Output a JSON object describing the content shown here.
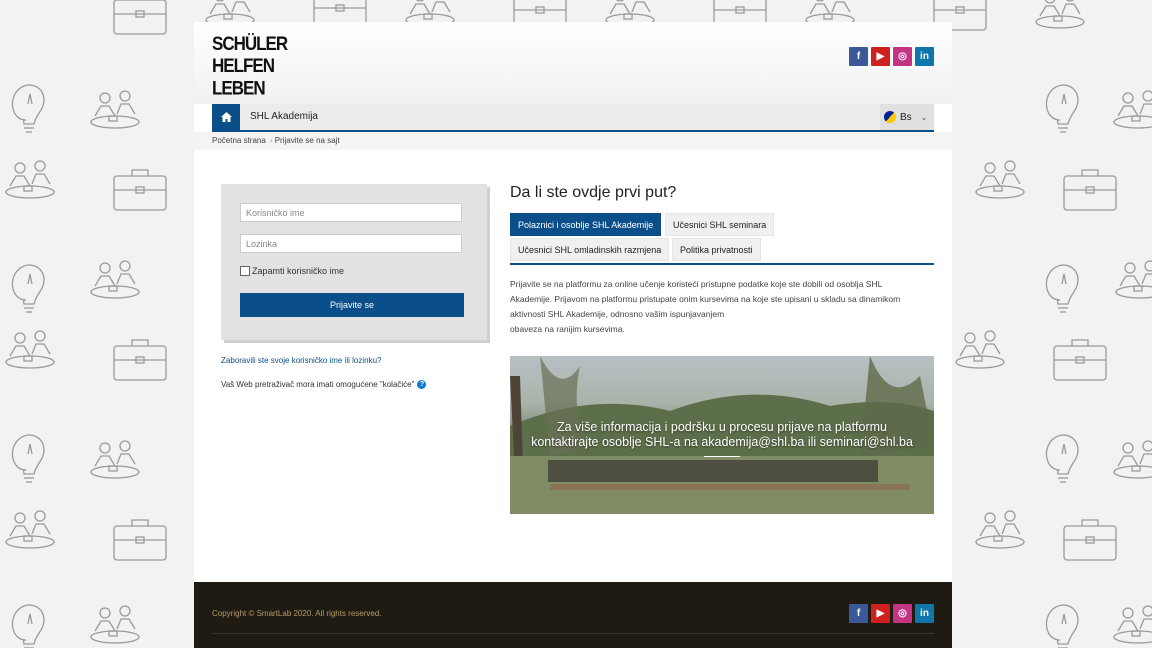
{
  "logo": {
    "lines": [
      "SCHÜLER",
      "HELFEN",
      "LEBEN"
    ]
  },
  "social": {
    "facebook": "f",
    "youtube": "▶",
    "instagram": "◎",
    "linkedin": "in"
  },
  "nav": {
    "home_icon": "home-icon",
    "title": "SHL Akademija",
    "language": "Bs"
  },
  "breadcrumb": {
    "home": "Početna strana",
    "current": "Prijavite se na sajt"
  },
  "login": {
    "username_placeholder": "Korisničko ime",
    "password_placeholder": "Lozinka",
    "remember_label": "Zapamti korisničko ime",
    "submit_label": "Prijavite se",
    "forgot_link": "Zaboravili ste svoje korisničko ime ili lozinku?",
    "cookies_notice": "Vaš Web pretraživač mora imati omogućene \"kolačiće\""
  },
  "info": {
    "title": "Da li ste ovdje prvi put?",
    "tabs": [
      {
        "label": "Polaznici i osoblje SHL Akademije",
        "active": true
      },
      {
        "label": "Učesnici SHL seminara",
        "active": false
      },
      {
        "label": "Učesnici SHL omladinskih razmjena",
        "active": false
      },
      {
        "label": "Politika privatnosti",
        "active": false
      }
    ],
    "intro_lines": [
      "Prijavite se na platformu za online učenje koristeći pristupne podatke koje ste dobili od osoblja SHL",
      "Akademije. Prijavom na platformu pristupate onim kursevima na koje ste upisani u skladu sa dinamikom",
      "aktivnosti SHL Akademije, odnosno vašim ispunjavanjem",
      "obaveza na ranijim kursevima."
    ],
    "banner_lines": [
      "Za više informacija i podršku u procesu prijave na platformu",
      "kontaktirajte  osoblje SHL-a na akademija@shl.ba ili seminari@shl.ba"
    ]
  },
  "footer": {
    "copyright": "Copyright © SmartLab 2020. All rights reserved."
  },
  "colors": {
    "primary": "#0a4f8a",
    "footer_bg": "#1f1a12",
    "footer_text": "#b29d6a"
  }
}
